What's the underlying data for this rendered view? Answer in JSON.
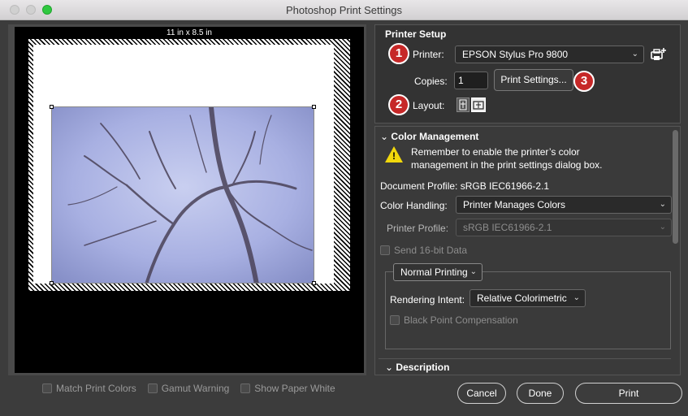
{
  "window": {
    "title": "Photoshop Print Settings"
  },
  "preview": {
    "paper_size": "11 in x 8.5 in"
  },
  "options": {
    "match_print_colors": "Match Print Colors",
    "gamut_warning": "Gamut Warning",
    "show_paper_white": "Show Paper White"
  },
  "printer_setup": {
    "title": "Printer Setup",
    "printer_label": "Printer:",
    "printer_value": "EPSON Stylus Pro 9800",
    "copies_label": "Copies:",
    "copies_value": "1",
    "print_settings_button": "Print Settings...",
    "layout_label": "Layout:"
  },
  "badges": {
    "one": "1",
    "two": "2",
    "three": "3"
  },
  "color_management": {
    "title": "Color Management",
    "warning_line1": "Remember to enable the printer’s color",
    "warning_line2": "management in the print settings dialog box.",
    "document_profile": "Document Profile: sRGB IEC61966-2.1",
    "color_handling_label": "Color Handling:",
    "color_handling_value": "Printer Manages Colors",
    "printer_profile_label": "Printer Profile:",
    "printer_profile_value": "sRGB IEC61966-2.1",
    "send_16bit": "Send 16-bit Data",
    "normal_printing": "Normal Printing",
    "rendering_intent_label": "Rendering Intent:",
    "rendering_intent_value": "Relative Colorimetric",
    "black_point": "Black Point Compensation"
  },
  "description": {
    "title": "Description"
  },
  "footer": {
    "cancel": "Cancel",
    "done": "Done",
    "print": "Print"
  },
  "colors": {
    "badge_red": "#c62828",
    "warning_yellow": "#f1d80c",
    "max_green": "#2fc840"
  }
}
